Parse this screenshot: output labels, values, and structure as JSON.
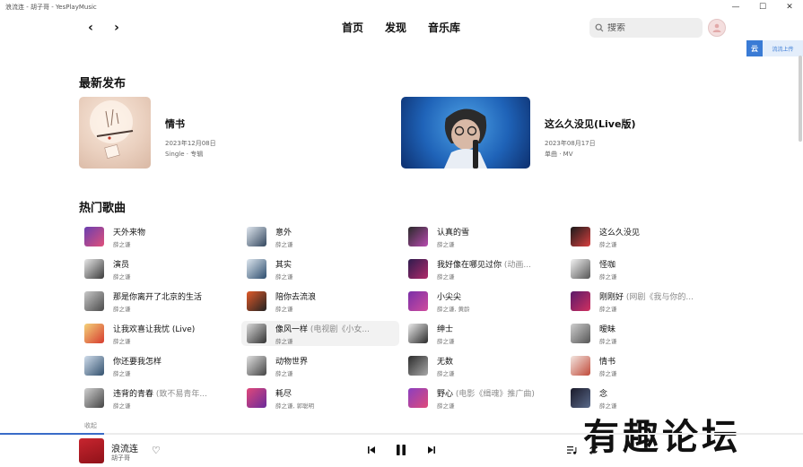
{
  "window": {
    "title": "浪流连 - 胡子哥 - YesPlayMusic",
    "buttons": {
      "minimize": "—",
      "maximize": "☐",
      "close": "✕"
    }
  },
  "nav": {
    "back_label": "‹",
    "forward_label": "›",
    "tabs": [
      "首页",
      "发现",
      "音乐库"
    ],
    "search_placeholder": "搜索"
  },
  "float_tool": {
    "icon_text": "云",
    "label": "流流上传"
  },
  "sections": {
    "latest": "最新发布",
    "hot": "热门歌曲",
    "collect": "收起"
  },
  "releases": [
    {
      "name": "情书",
      "date": "2023年12月08日",
      "type": "Single · 专辑"
    },
    {
      "name": "这么久没见(Live版)",
      "date": "2023年08月17日",
      "type": "单曲 · MV"
    }
  ],
  "songs": [
    {
      "title": "天外来物",
      "sub": "",
      "artist": "薛之谦"
    },
    {
      "title": "意外",
      "sub": "",
      "artist": "薛之谦"
    },
    {
      "title": "认真的雪",
      "sub": "",
      "artist": "薛之谦"
    },
    {
      "title": "这么久没见",
      "sub": "",
      "artist": "薛之谦"
    },
    {
      "title": "演员",
      "sub": "",
      "artist": "薛之谦"
    },
    {
      "title": "其实",
      "sub": "",
      "artist": "薛之谦"
    },
    {
      "title": "我好像在哪见过你",
      "sub": "(动画...",
      "artist": "薛之谦"
    },
    {
      "title": "怪咖",
      "sub": "",
      "artist": "薛之谦"
    },
    {
      "title": "那是你离开了北京的生活",
      "sub": "",
      "artist": "薛之谦"
    },
    {
      "title": "陪你去流浪",
      "sub": "",
      "artist": "薛之谦"
    },
    {
      "title": "小尖尖",
      "sub": "",
      "artist": "薛之谦, 黄龄"
    },
    {
      "title": "刚刚好",
      "sub": "(网剧《我与你的...",
      "artist": "薛之谦"
    },
    {
      "title": "让我欢喜让我忧 (Live)",
      "sub": "",
      "artist": "薛之谦"
    },
    {
      "title": "像风一样",
      "sub": "(电视剧《小女...",
      "artist": "薛之谦"
    },
    {
      "title": "绅士",
      "sub": "",
      "artist": "薛之谦"
    },
    {
      "title": "暧昧",
      "sub": "",
      "artist": "薛之谦"
    },
    {
      "title": "你还要我怎样",
      "sub": "",
      "artist": "薛之谦"
    },
    {
      "title": "动物世界",
      "sub": "",
      "artist": "薛之谦"
    },
    {
      "title": "无数",
      "sub": "",
      "artist": "薛之谦"
    },
    {
      "title": "情书",
      "sub": "",
      "artist": "薛之谦"
    },
    {
      "title": "违背的青春",
      "sub": "(致不易青年...",
      "artist": "薛之谦"
    },
    {
      "title": "耗尽",
      "sub": "",
      "artist": "薛之谦, 郭聪明"
    },
    {
      "title": "野心",
      "sub": "(电影《缉魂》推广曲)",
      "artist": "薛之谦"
    },
    {
      "title": "念",
      "sub": "",
      "artist": "薛之谦"
    }
  ],
  "player": {
    "title": "浪流连",
    "artist": "胡子哥",
    "progress": 0.13,
    "prev_icon": "skip-previous-icon",
    "play_icon": "pause-icon",
    "next_icon": "skip-next-icon"
  },
  "watermark": "有趣论坛"
}
